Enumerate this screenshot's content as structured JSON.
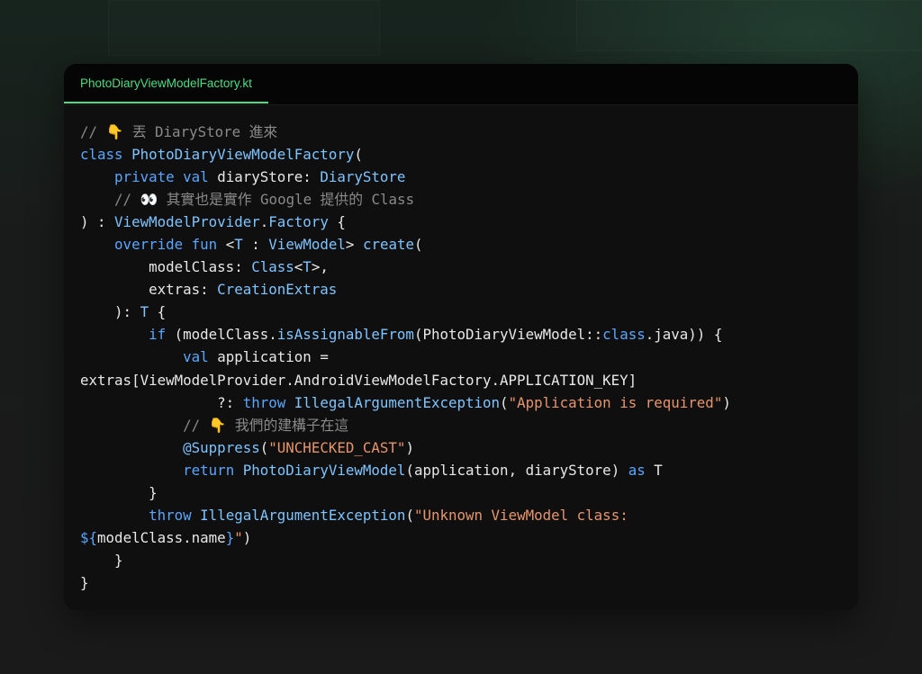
{
  "file_tab": {
    "label": "PhotoDiaryViewModelFactory.kt"
  },
  "colors": {
    "tab_accent": "#4ade80",
    "keyword": "#5aa6ff",
    "type": "#7ec4ff",
    "string": "#e8956c",
    "comment": "#8a8a8a",
    "plain": "#e8e8e8",
    "card_background": "#0f0f0f"
  },
  "code": {
    "lines": [
      [
        {
          "t": "cm",
          "v": "// 👇 丟 DiaryStore 進來"
        }
      ],
      [
        {
          "t": "kw",
          "v": "class"
        },
        {
          "t": "",
          "v": " "
        },
        {
          "t": "ty",
          "v": "PhotoDiaryViewModelFactory"
        },
        {
          "t": "",
          "v": "("
        }
      ],
      [
        {
          "t": "",
          "v": "    "
        },
        {
          "t": "kw",
          "v": "private"
        },
        {
          "t": "",
          "v": " "
        },
        {
          "t": "kw",
          "v": "val"
        },
        {
          "t": "",
          "v": " diaryStore: "
        },
        {
          "t": "ty",
          "v": "DiaryStore"
        }
      ],
      [
        {
          "t": "",
          "v": "    "
        },
        {
          "t": "cm",
          "v": "// 👀 其實也是實作 Google 提供的 Class"
        }
      ],
      [
        {
          "t": "",
          "v": ") : "
        },
        {
          "t": "ty",
          "v": "ViewModelProvider"
        },
        {
          "t": "",
          "v": "."
        },
        {
          "t": "ty",
          "v": "Factory"
        },
        {
          "t": "",
          "v": " {"
        }
      ],
      [
        {
          "t": "",
          "v": "    "
        },
        {
          "t": "kw",
          "v": "override"
        },
        {
          "t": "",
          "v": " "
        },
        {
          "t": "kw",
          "v": "fun"
        },
        {
          "t": "",
          "v": " <"
        },
        {
          "t": "ty",
          "v": "T"
        },
        {
          "t": "",
          "v": " : "
        },
        {
          "t": "ty",
          "v": "ViewModel"
        },
        {
          "t": "",
          "v": "> "
        },
        {
          "t": "ty",
          "v": "create"
        },
        {
          "t": "",
          "v": "("
        }
      ],
      [
        {
          "t": "",
          "v": "        modelClass: "
        },
        {
          "t": "ty",
          "v": "Class"
        },
        {
          "t": "",
          "v": "<"
        },
        {
          "t": "ty",
          "v": "T"
        },
        {
          "t": "",
          "v": ">,"
        }
      ],
      [
        {
          "t": "",
          "v": "        extras: "
        },
        {
          "t": "ty",
          "v": "CreationExtras"
        }
      ],
      [
        {
          "t": "",
          "v": "    ): "
        },
        {
          "t": "ty",
          "v": "T"
        },
        {
          "t": "",
          "v": " {"
        }
      ],
      [
        {
          "t": "",
          "v": "        "
        },
        {
          "t": "kw",
          "v": "if"
        },
        {
          "t": "",
          "v": " (modelClass."
        },
        {
          "t": "ty",
          "v": "isAssignableFrom"
        },
        {
          "t": "",
          "v": "(PhotoDiaryViewModel::"
        },
        {
          "t": "kw",
          "v": "class"
        },
        {
          "t": "",
          "v": ".java)) {"
        }
      ],
      [
        {
          "t": "",
          "v": "            "
        },
        {
          "t": "kw",
          "v": "val"
        },
        {
          "t": "",
          "v": " application ="
        }
      ],
      [
        {
          "t": "",
          "v": "extras[ViewModelProvider.AndroidViewModelFactory.APPLICATION_KEY]"
        }
      ],
      [
        {
          "t": "",
          "v": "                ?: "
        },
        {
          "t": "kw",
          "v": "throw"
        },
        {
          "t": "",
          "v": " "
        },
        {
          "t": "ty",
          "v": "IllegalArgumentException"
        },
        {
          "t": "",
          "v": "("
        },
        {
          "t": "st",
          "v": "\"Application is required\""
        },
        {
          "t": "",
          "v": ")"
        }
      ],
      [
        {
          "t": "",
          "v": "            "
        },
        {
          "t": "cm",
          "v": "// 👇 我們的建構子在這"
        }
      ],
      [
        {
          "t": "",
          "v": "            "
        },
        {
          "t": "an",
          "v": "@Suppress"
        },
        {
          "t": "",
          "v": "("
        },
        {
          "t": "st",
          "v": "\"UNCHECKED_CAST\""
        },
        {
          "t": "",
          "v": ")"
        }
      ],
      [
        {
          "t": "",
          "v": "            "
        },
        {
          "t": "kw",
          "v": "return"
        },
        {
          "t": "",
          "v": " "
        },
        {
          "t": "ty",
          "v": "PhotoDiaryViewModel"
        },
        {
          "t": "",
          "v": "(application, diaryStore) "
        },
        {
          "t": "kw",
          "v": "as"
        },
        {
          "t": "",
          "v": " T"
        }
      ],
      [
        {
          "t": "",
          "v": "        }"
        }
      ],
      [
        {
          "t": "",
          "v": "        "
        },
        {
          "t": "kw",
          "v": "throw"
        },
        {
          "t": "",
          "v": " "
        },
        {
          "t": "ty",
          "v": "IllegalArgumentException"
        },
        {
          "t": "",
          "v": "("
        },
        {
          "t": "st",
          "v": "\"Unknown ViewModel class:"
        }
      ],
      [
        {
          "t": "kw",
          "v": "${"
        },
        {
          "t": "",
          "v": "modelClass.name"
        },
        {
          "t": "kw",
          "v": "}"
        },
        {
          "t": "st",
          "v": "\""
        },
        {
          "t": "",
          "v": ")"
        }
      ],
      [
        {
          "t": "",
          "v": "    }"
        }
      ],
      [
        {
          "t": "",
          "v": "}"
        }
      ]
    ]
  }
}
